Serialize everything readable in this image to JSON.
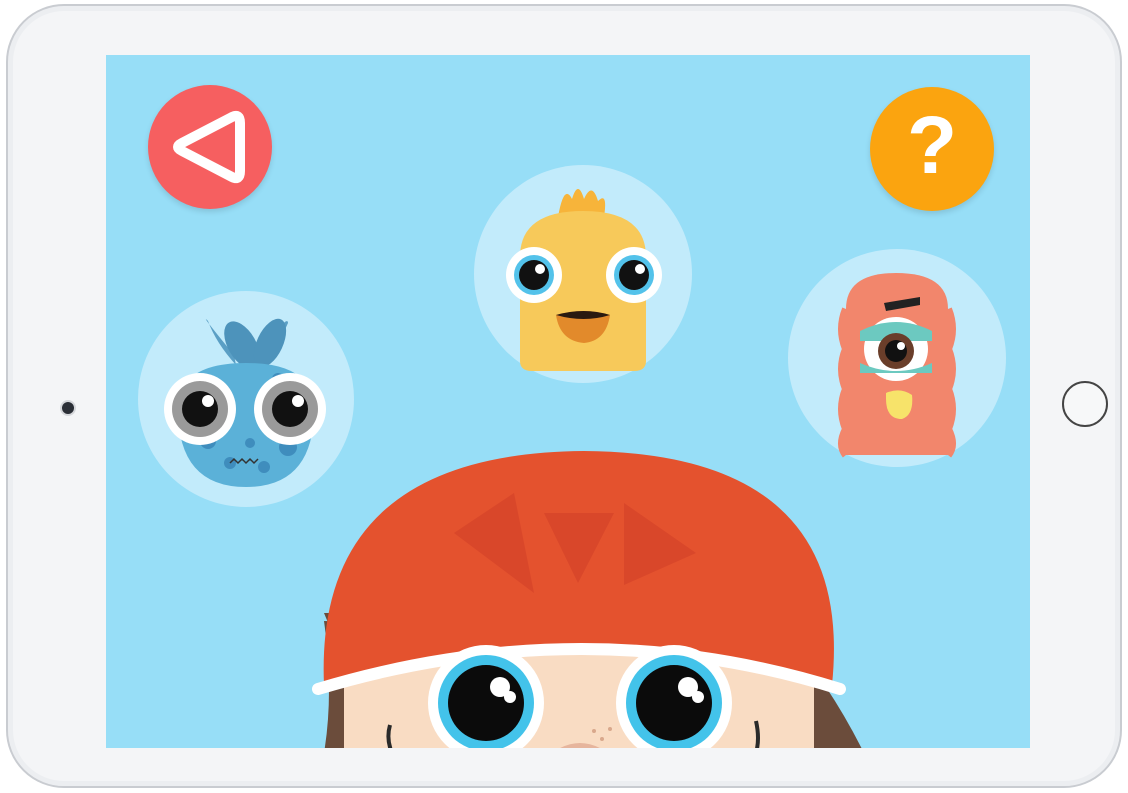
{
  "device": {
    "frame_color": "#f4f5f7",
    "screen_color": "#97def7"
  },
  "toolbar": {
    "back_icon": "back-triangle-icon",
    "back_color": "#f65f60",
    "help_label": "?",
    "help_color": "#fba40f"
  },
  "characters": [
    {
      "name": "blue-bug",
      "color": "#5bb1d8"
    },
    {
      "name": "yellow-chick",
      "color": "#f7c95a"
    },
    {
      "name": "red-cyclops",
      "color": "#f2866c"
    }
  ],
  "avatar": {
    "name": "child-with-helmet",
    "helmet_color": "#e4522e",
    "hair_color": "#6b4c3b"
  }
}
